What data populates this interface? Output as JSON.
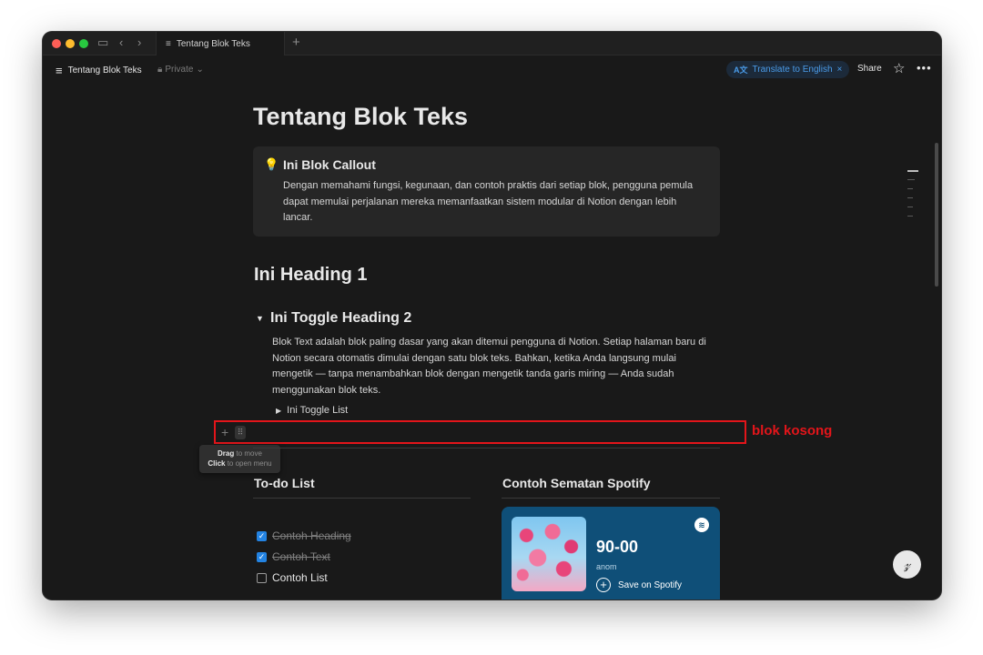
{
  "tab": {
    "title": "Tentang Blok Teks",
    "new_tab_icon": "plus-icon"
  },
  "topbar": {
    "page_title": "Tentang Blok Teks",
    "privacy": "Private",
    "translate_label": "Translate to English",
    "share_label": "Share"
  },
  "page": {
    "title": "Tentang Blok Teks",
    "callout": {
      "icon": "💡",
      "title": "Ini Blok Callout",
      "body": "Dengan memahami fungsi, kegunaan, dan contoh praktis dari setiap blok, pengguna pemula dapat memulai perjalanan mereka memanfaatkan sistem modular di Notion dengan lebih lancar."
    },
    "heading1": "Ini Heading 1",
    "toggle_heading2": "Ini Toggle Heading 2",
    "paragraph": "Blok Text adalah blok paling dasar yang akan ditemui pengguna di Notion. Setiap halaman baru di Notion secara otomatis dimulai dengan satu blok teks. Bahkan, ketika Anda langsung mulai mengetik — tanpa menambahkan blok dengan mengetik tanda garis miring — Anda sudah menggunakan blok teks.",
    "toggle_list": "Ini Toggle List",
    "tooltip": {
      "drag_bold": "Drag",
      "drag_rest": "to move",
      "click_bold": "Click",
      "click_rest": "to open menu"
    },
    "todo": {
      "title": "To-do List",
      "items": [
        {
          "label": "Contoh Heading",
          "checked": true
        },
        {
          "label": "Contoh Text",
          "checked": true
        },
        {
          "label": "Contoh List",
          "checked": false
        }
      ]
    },
    "spotify": {
      "section_title": "Contoh Sematan Spotify",
      "track": "90-00",
      "artist": "anom",
      "save_label": "Save on Spotify"
    }
  },
  "annotation": {
    "label": "blok kosong",
    "color": "#e3151a"
  },
  "colors": {
    "background": "#191919",
    "accent_blue": "#2383e2",
    "spotify_card": "#0f4f78"
  }
}
